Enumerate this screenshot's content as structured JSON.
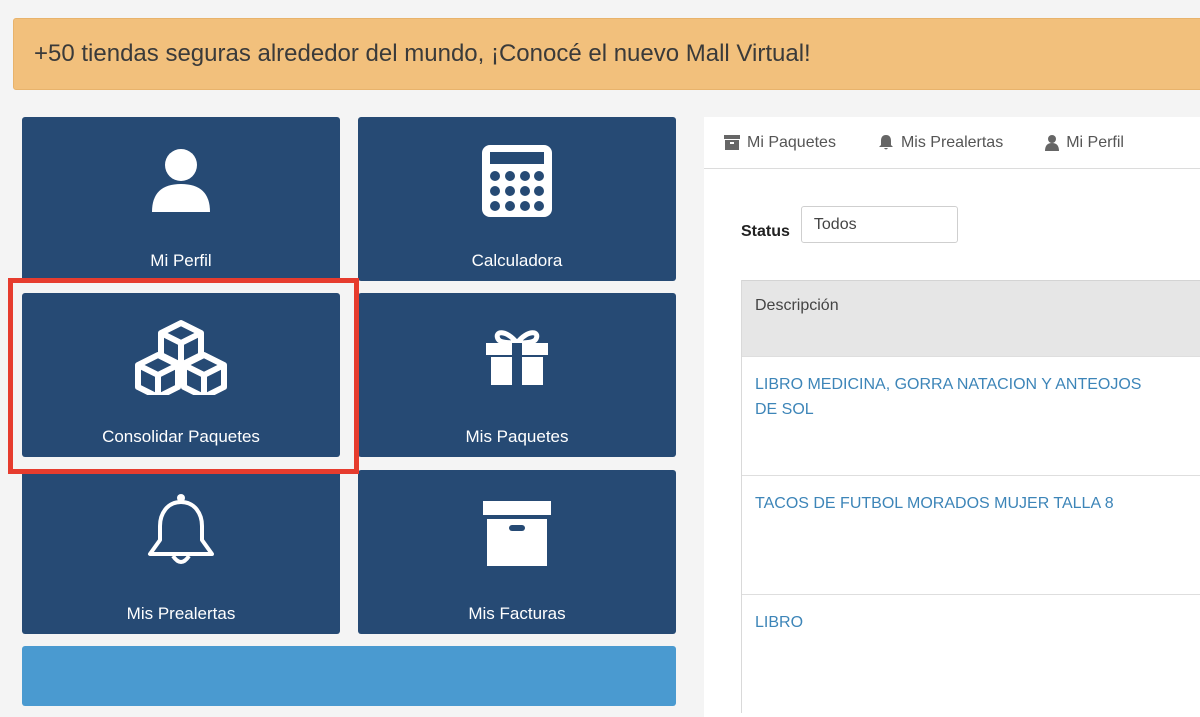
{
  "banner": {
    "text": "+50 tiendas seguras alrededor del mundo, ¡Conocé el nuevo Mall Virtual!"
  },
  "tiles": {
    "profile": "Mi Perfil",
    "calculator": "Calculadora",
    "consolidate": "Consolidar Paquetes",
    "packages": "Mis Paquetes",
    "prealerts": "Mis Prealertas",
    "invoices": "Mis Facturas"
  },
  "tabs": {
    "packages": "Mi Paquetes",
    "prealerts": "Mis Prealertas",
    "profile": "Mi Perfil"
  },
  "filter": {
    "label": "Status",
    "value": "Todos"
  },
  "table": {
    "header": "Descripción",
    "rows": [
      "LIBRO MEDICINA, GORRA NATACION Y ANTEOJOS DE SOL",
      "TACOS DE FUTBOL MORADOS MUJER TALLA 8",
      "LIBRO"
    ]
  },
  "colors": {
    "tile": "#264a74",
    "banner": "#f2c07c",
    "highlight": "#e63c2e",
    "link": "#3d85b8"
  }
}
